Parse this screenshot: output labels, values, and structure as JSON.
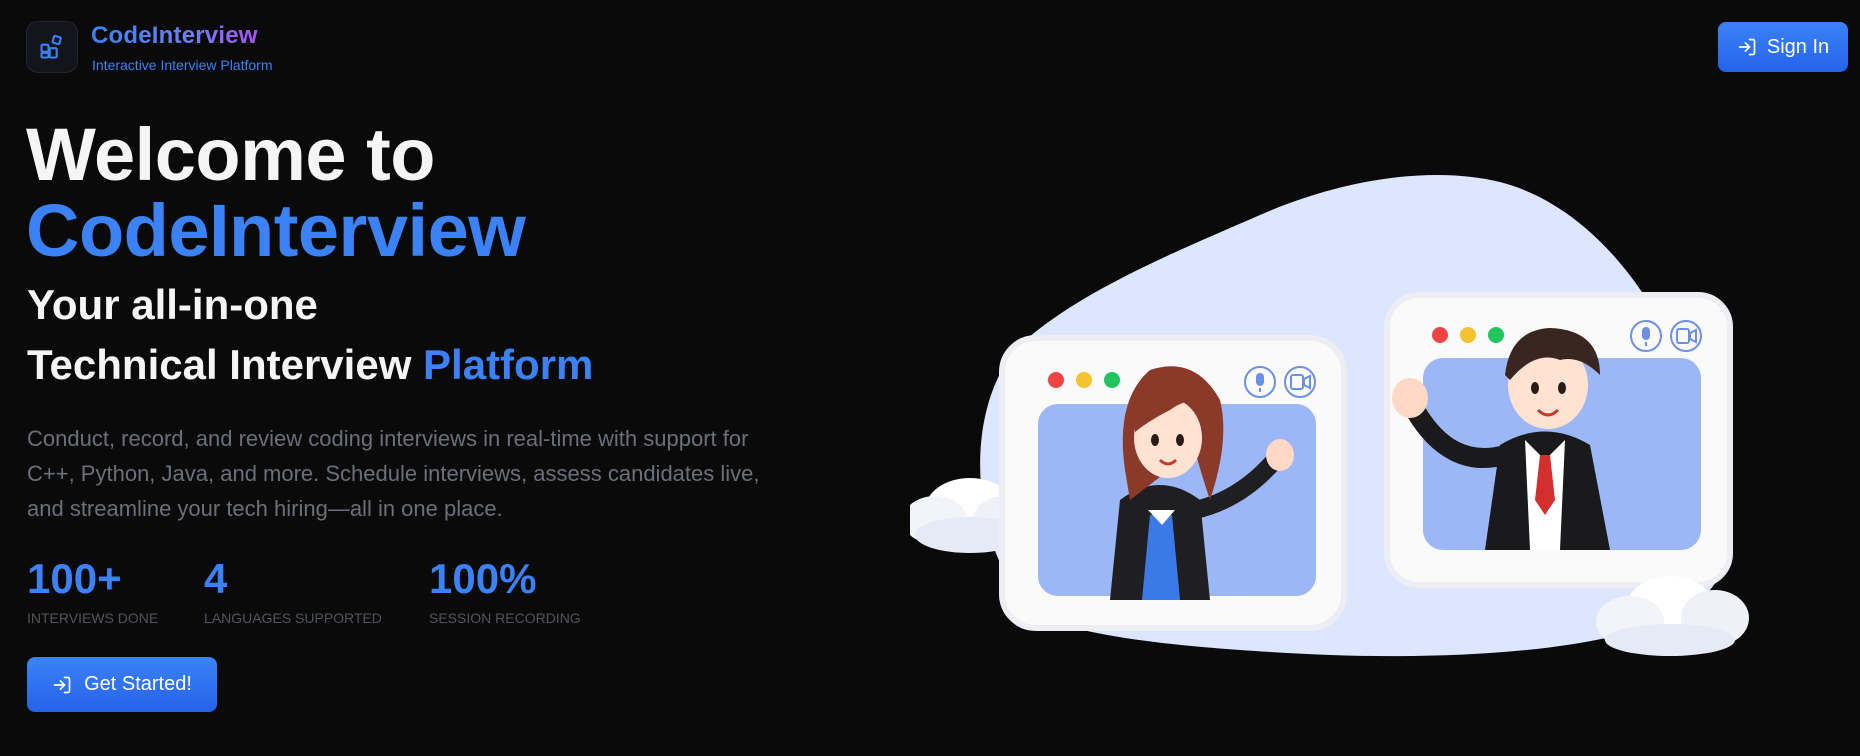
{
  "header": {
    "brand_title": "CodeInterview",
    "brand_subtitle": "Interactive Interview Platform",
    "logo_icon": "layout-grid-icon",
    "signin_label": "Sign In",
    "signin_icon": "log-in-icon"
  },
  "hero": {
    "welcome": "Welcome to",
    "brand": "CodeInterview",
    "tagline_line1": "Your all-in-one",
    "tagline_line2_prefix": "Technical Interview ",
    "tagline_line2_accent": "Platform",
    "description": "Conduct, record, and review coding interviews in real-time with support for C++, Python, Java, and more. Schedule interviews, assess candidates live, and streamline your tech hiring—all in one place."
  },
  "stats": [
    {
      "value": "100+",
      "label": "INTERVIEWS DONE"
    },
    {
      "value": "4",
      "label": "LANGUAGES SUPPORTED"
    },
    {
      "value": "100%",
      "label": "SESSION RECORDING"
    }
  ],
  "cta": {
    "label": "Get Started!",
    "icon": "log-in-icon"
  },
  "illustration": {
    "icons": [
      "microphone-icon",
      "video-camera-icon"
    ],
    "colors": {
      "accent": "#3b82f6",
      "blob": "#dde6ff",
      "screen": "#9cb7f5"
    }
  }
}
